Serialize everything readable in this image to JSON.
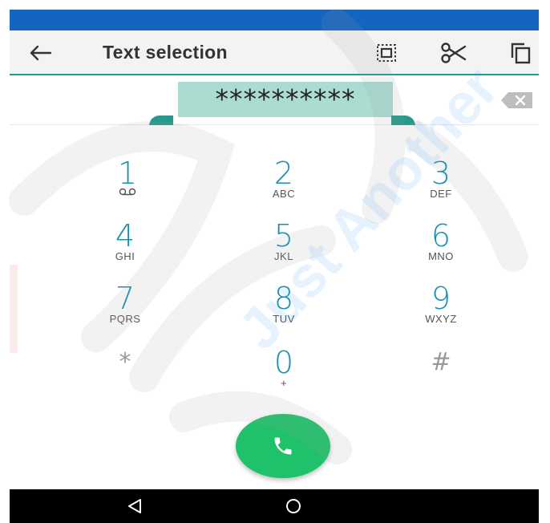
{
  "action_bar": {
    "title": "Text selection",
    "icons": [
      "back-arrow-icon",
      "select-all-icon",
      "cut-icon",
      "copy-icon"
    ],
    "accent_color": "#1f9c8a"
  },
  "dial_input": {
    "value": "**********",
    "selection_color": "#aadcd2"
  },
  "dialpad": {
    "keys": [
      {
        "digit": "1",
        "letters": ""
      },
      {
        "digit": "2",
        "letters": "ABC"
      },
      {
        "digit": "3",
        "letters": "DEF"
      },
      {
        "digit": "4",
        "letters": "GHI"
      },
      {
        "digit": "5",
        "letters": "JKL"
      },
      {
        "digit": "6",
        "letters": "MNO"
      },
      {
        "digit": "7",
        "letters": "PQRS"
      },
      {
        "digit": "8",
        "letters": "TUV"
      },
      {
        "digit": "9",
        "letters": "WXYZ"
      },
      {
        "digit": "*",
        "letters": ""
      },
      {
        "digit": "0",
        "letters": "+"
      },
      {
        "digit": "#",
        "letters": ""
      }
    ],
    "digit_color": "#1a8fb0",
    "call_button_color": "#1fc26b"
  },
  "colors": {
    "status_bar": "#1565C0",
    "nav_bar": "#000000"
  },
  "watermark": {
    "text": "Just Another"
  }
}
